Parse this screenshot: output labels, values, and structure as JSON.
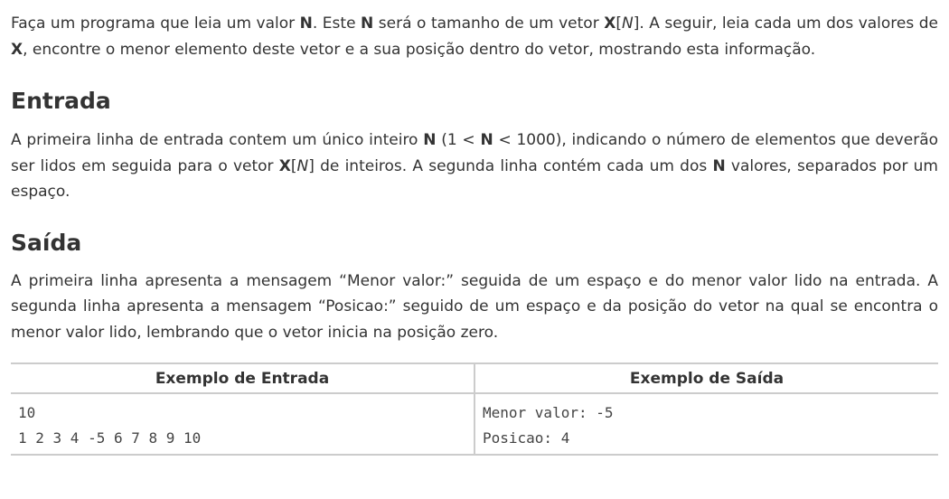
{
  "intro": {
    "t1": "Faça um programa que leia um valor ",
    "b1": "N",
    "t2": ". Este ",
    "b2": "N",
    "t3": " será o tamanho de um vetor ",
    "b3": "X",
    "t4": "[",
    "i1": "N",
    "t5": "]. A seguir, leia cada um dos valores de ",
    "b4": "X",
    "t6": ", encontre o menor elemento deste vetor e a sua posição dentro do vetor, mostrando esta informação."
  },
  "input_section": {
    "heading": "Entrada",
    "t1": "A primeira linha de entrada contem um único inteiro ",
    "b1": "N",
    "t2": " (1 < ",
    "b2": "N",
    "t3": " < 1000), indicando o número de elementos que deverão ser lidos em seguida para o vetor ",
    "b3": "X",
    "t4": "[",
    "i1": "N",
    "t5": "] de inteiros. A segunda linha contém cada um dos ",
    "b4": "N",
    "t6": " valores, separados por um espaço."
  },
  "output_section": {
    "heading": "Saída",
    "text": "A primeira linha apresenta a mensagem “Menor valor:” seguida de um espaço e do menor valor lido na entrada. A segunda linha apresenta a mensagem “Posicao:” seguido de um espaço e da posição do vetor na qual se encontra o menor valor lido, lembrando que o vetor inicia na posição zero."
  },
  "examples": {
    "input_header": "Exemplo de Entrada",
    "output_header": "Exemplo de Saída",
    "input_lines": [
      "10",
      "1 2 3 4 -5 6 7 8 9 10"
    ],
    "output_lines": [
      "Menor valor: -5",
      "Posicao: 4"
    ]
  }
}
